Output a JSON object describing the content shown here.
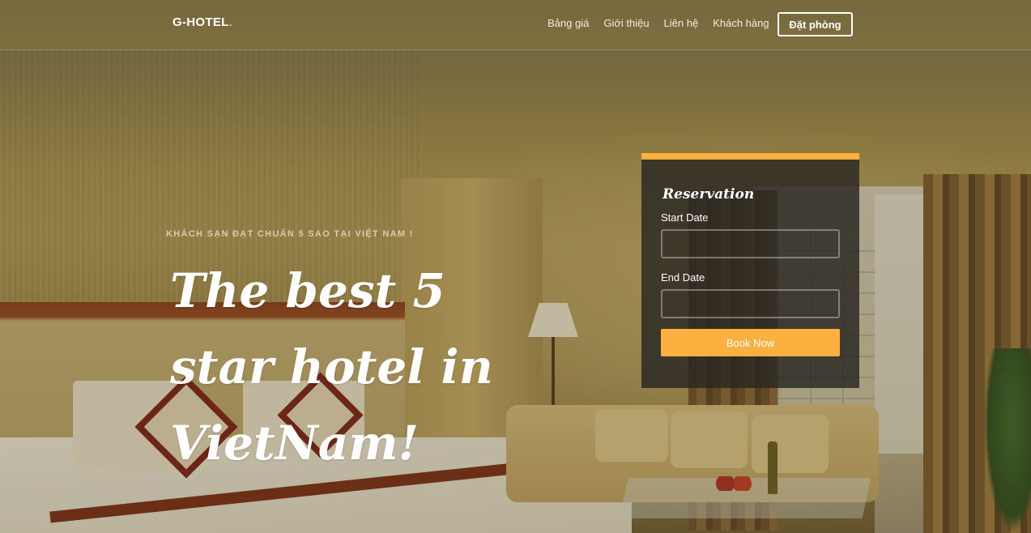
{
  "nav": {
    "brand": "G-HOTEL",
    "brand_dot": ".",
    "links": [
      "Bảng giá",
      "Giới thiệu",
      "Liên hệ",
      "Khách hàng"
    ],
    "cta": "Đặt phòng"
  },
  "hero": {
    "subtitle": "KHÁCH SẠN ĐẠT CHUẨN 5 SAO TẠI VIỆT NAM !",
    "headline": "The best 5 star hotel in VietNam!"
  },
  "reservation": {
    "title": "Reservation",
    "start_label": "Start Date",
    "start_value": "",
    "end_label": "End Date",
    "end_value": "",
    "button": "Book Now"
  },
  "colors": {
    "accent": "#fbb040",
    "panel": "#28261f"
  }
}
